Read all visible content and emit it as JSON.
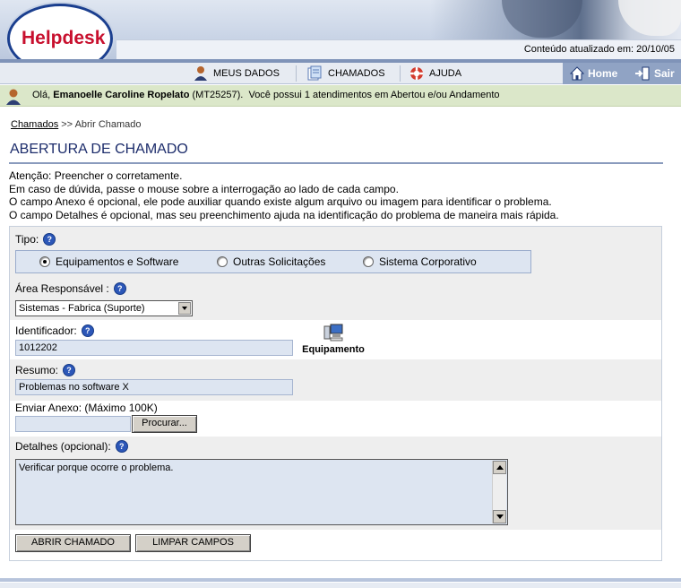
{
  "header": {
    "logo_text": "Helpdesk",
    "update_text": "Conteúdo atualizado em: 20/10/05"
  },
  "nav": {
    "items": [
      {
        "label": "MEUS DADOS",
        "icon": "user-icon"
      },
      {
        "label": "CHAMADOS",
        "icon": "tickets-icon"
      },
      {
        "label": "AJUDA",
        "icon": "lifebuoy-icon"
      }
    ],
    "home_label": "Home",
    "exit_label": "Sair"
  },
  "greeting": {
    "prefix": "Olá, ",
    "user": "Emanoelle Caroline Ropelato",
    "suffix": " (MT25257).  Você possui 1 atendimentos em Abertou e/ou Andamento"
  },
  "breadcrumb": {
    "link": "Chamados",
    "sep": " >> ",
    "current": "Abrir Chamado"
  },
  "page_title": "ABERTURA DE CHAMADO",
  "notes": [
    "Atenção: Preencher o corretamente.",
    "Em caso de dúvida, passe o mouse sobre a interrogação ao lado de cada campo.",
    "O campo Anexo é opcional, ele pode auxiliar quando existe algum arquivo ou imagem para identificar o problema.",
    "O campo Detalhes é opcional, mas seu preenchimento ajuda na identificação do problema de maneira mais rápida."
  ],
  "form": {
    "tipo_label": "Tipo:",
    "tipo_options": [
      {
        "label": "Equipamentos e Software",
        "selected": true
      },
      {
        "label": "Outras Solicitações",
        "selected": false
      },
      {
        "label": "Sistema Corporativo",
        "selected": false
      }
    ],
    "area_label": "Área Responsável :",
    "area_value": "Sistemas - Fabrica (Suporte)",
    "identificador_label": "Identificador:",
    "identificador_value": "1012202",
    "equipamento_label": "Equipamento",
    "resumo_label": "Resumo:",
    "resumo_value": "Problemas no software X",
    "anexo_label": "Enviar Anexo: (Máximo 100K)",
    "anexo_value": "",
    "browse_label": "Procurar...",
    "detalhes_label": "Detalhes (opcional):",
    "detalhes_value": "Verificar porque ocorre o problema.",
    "submit_label": "ABRIR CHAMADO",
    "clear_label": "LIMPAR CAMPOS",
    "help_glyph": "?"
  },
  "colors": {
    "title": "#1c2c6b",
    "logo": "#c8102e",
    "greeting_bg": "#dbe7c9",
    "field_bg": "#dde5f1"
  }
}
